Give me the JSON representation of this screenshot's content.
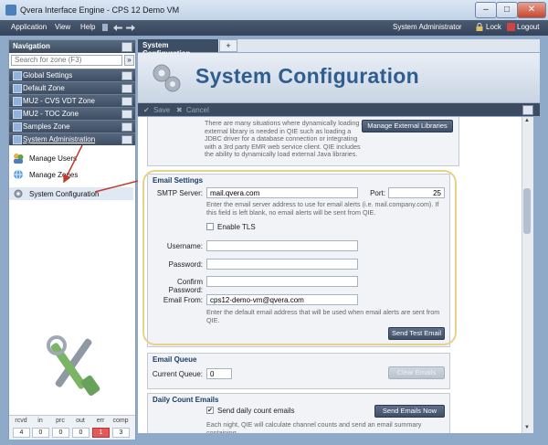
{
  "window": {
    "title": "Qvera Interface Engine - CPS 12 Demo VM",
    "minimize_label": "–",
    "maximize_label": "□",
    "close_label": "✕"
  },
  "menu": {
    "application": "Application",
    "view": "View",
    "help": "Help",
    "user": "System Administrator",
    "lock": "Lock",
    "logout": "Logout"
  },
  "nav": {
    "header": "Navigation",
    "search_placeholder": "Search for zone (F3)",
    "search_button": "»",
    "groups": [
      {
        "label": "Global Settings"
      },
      {
        "label": "Default Zone"
      },
      {
        "label": "MU2 - CVS VDT Zone"
      },
      {
        "label": "MU2 - TOC Zone"
      },
      {
        "label": "Samples Zone"
      },
      {
        "label": "System Administration"
      }
    ],
    "sub_items": [
      {
        "label": "Manage Users",
        "icon": "users-icon"
      },
      {
        "label": "Manage Zones",
        "icon": "zones-icon"
      },
      {
        "label": "System Configuration",
        "icon": "gear-icon"
      }
    ],
    "stats": {
      "labels": [
        "rcvd",
        "in",
        "prc",
        "out",
        "err",
        "comp"
      ],
      "values": [
        "4",
        "0",
        "0",
        "0",
        "1",
        "3"
      ]
    }
  },
  "tabs": {
    "active": "System Configuration",
    "add": "+"
  },
  "banner": {
    "title": "System Configuration"
  },
  "toolbar": {
    "save": "Save",
    "cancel": "Cancel"
  },
  "external_libraries": {
    "description": "There are many situations where dynamically loading an external library is needed in QIE such as loading a JDBC driver for a database connection or integrating with a 3rd party EMR web service client. QIE includes the ability to dynamically load external Java libraries.",
    "button": "Manage External Libraries"
  },
  "email_settings": {
    "title": "Email Settings",
    "smtp_label": "SMTP Server:",
    "smtp_value": "mail.qvera.com",
    "port_label": "Port:",
    "port_value": "25",
    "smtp_desc": "Enter the email server address to use for email alerts (i.e. mail.company.com). If this field is left blank, no email alerts will be sent from QIE.",
    "tls_label": "Enable TLS",
    "username_label": "Username:",
    "username_value": "",
    "password_label": "Password:",
    "password_value": "",
    "confirm_label": "Confirm Password:",
    "confirm_value": "",
    "from_label": "Email From:",
    "from_value": "cps12-demo-vm@qvera.com",
    "from_desc": "Enter the default email address that will be used when email alerts are sent from QIE.",
    "test_button": "Send Test Email"
  },
  "email_queue": {
    "title": "Email Queue",
    "current_label": "Current Queue:",
    "current_value": "0",
    "clear_button": "Clear Emails"
  },
  "daily_count": {
    "title": "Daily Count Emails",
    "send_label": "Send daily count emails",
    "send_now_button": "Send Emails Now",
    "desc": "Each night, QIE will calculate channel counts and send an email summary containing"
  },
  "colors": {
    "accent": "#2f5d8f",
    "nav_dark": "#3e4d62",
    "highlight": "#e8d28a",
    "arrow": "#c0392b"
  }
}
